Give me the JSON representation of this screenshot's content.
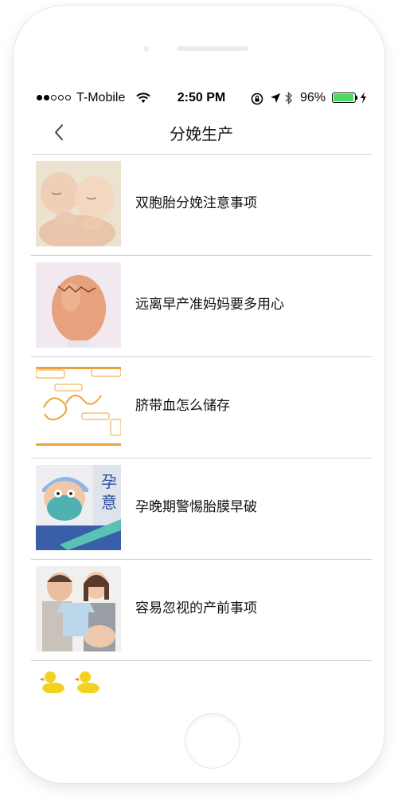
{
  "status_bar": {
    "signal_bars": [
      true,
      true,
      false,
      false,
      false
    ],
    "carrier": "T-Mobile",
    "time": "2:50 PM",
    "battery_percent": "96%",
    "battery_level": 0.96,
    "battery_color": "#4cd964"
  },
  "nav": {
    "back_icon": "chevron-left-icon",
    "title": "分娩生产"
  },
  "articles": [
    {
      "title": "双胞胎分娩注意事项",
      "thumbnail": "twin-babies-photo"
    },
    {
      "title": "远离早产准妈妈要多用心",
      "thumbnail": "cracked-egg-photo"
    },
    {
      "title": "脐带血怎么储存",
      "thumbnail": "umbilical-cord-diagram"
    },
    {
      "title": "孕晚期警惕胎膜早破",
      "thumbnail": "doctor-mask-photo"
    },
    {
      "title": "容易忽视的产前事项",
      "thumbnail": "expecting-couple-photo"
    },
    {
      "title": "",
      "thumbnail": "rubber-ducks-photo"
    }
  ]
}
